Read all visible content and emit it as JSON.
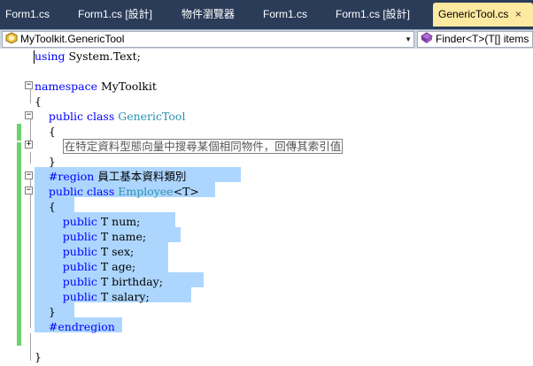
{
  "tabs": [
    {
      "label": "Form1.cs"
    },
    {
      "label": "Form1.cs [設計]"
    },
    {
      "label": "物件瀏覽器"
    },
    {
      "label": "Form1.cs"
    },
    {
      "label": "Form1.cs [設計]"
    },
    {
      "label": "GenericTool.cs",
      "active": true
    }
  ],
  "tab_close_glyph": "×",
  "navbar": {
    "type_combo": "MyToolkit.GenericTool",
    "member_combo": "Finder<T>(T[] items"
  },
  "code": {
    "line1": {
      "kw": "using",
      "rest": " System.Text;"
    },
    "line3": {
      "kw": "namespace",
      "rest": " MyToolkit"
    },
    "line4": "{",
    "line5": {
      "kw1": "public",
      "kw2": "class",
      "type": "GenericTool"
    },
    "line6": "{",
    "line7_collapsed": "在特定資料型態向量中搜尋某個相同物件，回傳其索引值",
    "line8": "}",
    "line9": {
      "kw": "#region",
      "rest": " 員工基本資料類別"
    },
    "line10": {
      "kw1": "public",
      "kw2": "class",
      "type": "Employee",
      "rest": "<T>"
    },
    "line11": "{",
    "fields": [
      {
        "kw": "public",
        "rest": " T num;"
      },
      {
        "kw": "public",
        "rest": " T name;"
      },
      {
        "kw": "public",
        "rest": " T sex;"
      },
      {
        "kw": "public",
        "rest": " T age;"
      },
      {
        "kw": "public",
        "rest": " T birthday;"
      },
      {
        "kw": "public",
        "rest": " T salary;"
      }
    ],
    "line18": "}",
    "line19": "#endregion",
    "line21": "}"
  },
  "colors": {
    "keyword": "#0000ff",
    "type": "#2b91af",
    "selection": "#add6ff",
    "change_bar": "#6bd36b",
    "tab_strip": "#2b3c59",
    "active_tab": "#fde9a0"
  }
}
